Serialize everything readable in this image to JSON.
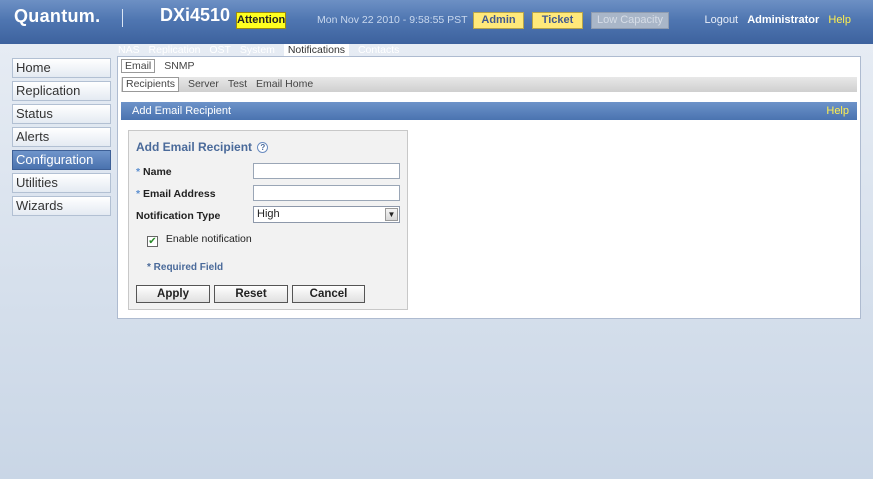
{
  "header": {
    "logo": "Quantum.",
    "product": "DXi4510",
    "attention": "Attention",
    "datetime": "Mon Nov 22 2010 - 9:58:55 PST",
    "admin": "Admin",
    "ticket": "Ticket",
    "low_capacity": "Low Capacity",
    "logout": "Logout",
    "user": "Administrator",
    "help": "Help"
  },
  "nav": [
    "Home",
    "Replication",
    "Status",
    "Alerts",
    "Configuration",
    "Utilities",
    "Wizards"
  ],
  "tabs": [
    "NAS",
    "Replication",
    "OST",
    "System",
    "Notifications",
    "Contacts"
  ],
  "subtabs": [
    "Email",
    "SNMP"
  ],
  "email_tabs": [
    "Recipients",
    "Server",
    "Test",
    "Email Home"
  ],
  "section": {
    "title": "Add Email Recipient",
    "help": "Help"
  },
  "form": {
    "title": "Add Email Recipient",
    "help_icon": "?",
    "name_label": "Name",
    "email_label": "Email Address",
    "notification_label": "Notification Type",
    "notification_value": "High",
    "enable_label": "Enable notification",
    "enable_checked": true,
    "required_note": "* Required Field",
    "required_mark": "*",
    "apply": "Apply",
    "reset": "Reset",
    "cancel": "Cancel",
    "name_value": "",
    "email_value": ""
  },
  "colors": {
    "header": "#4f76b1",
    "accent_yellow": "#ffff20",
    "nav_active": "#4a72ae"
  }
}
